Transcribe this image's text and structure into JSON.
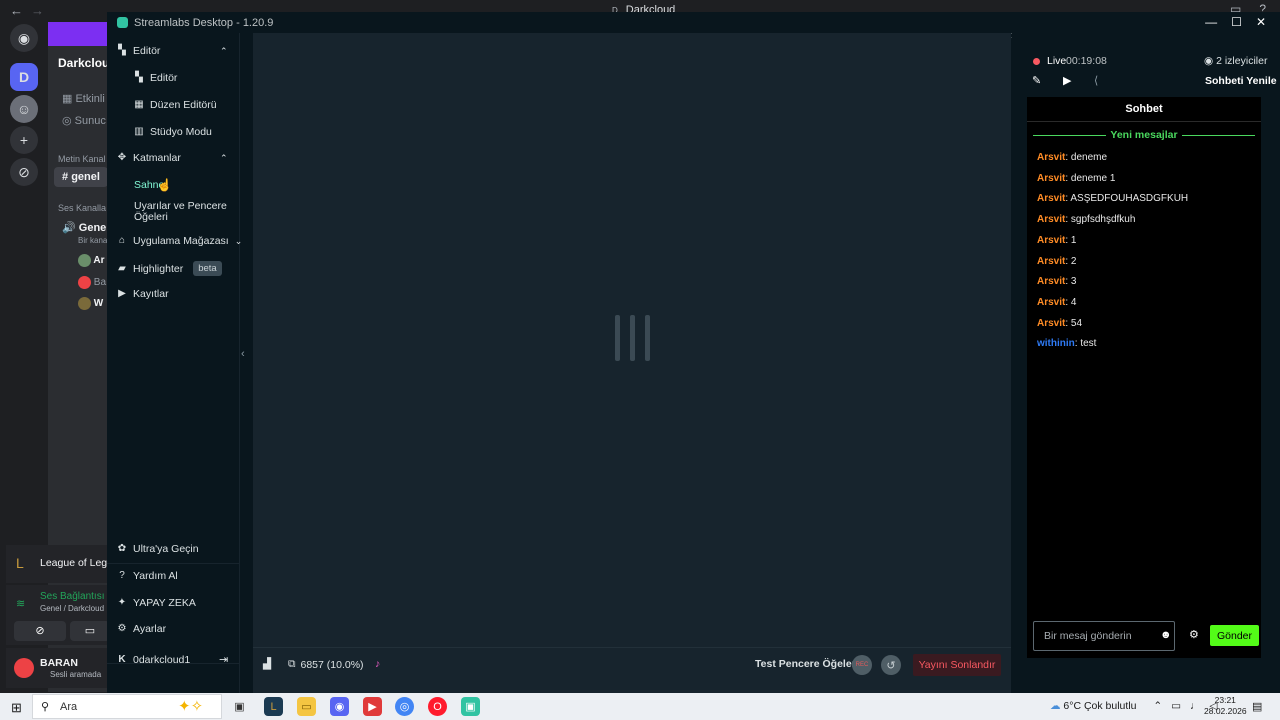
{
  "discord": {
    "window_title": "Darkcloud",
    "server_initial": "D",
    "server_name": "Darkcloud",
    "channels": {
      "events": "Etkinli",
      "server_guide": "Sunuc",
      "text_header": "Metin Kanal",
      "text_channel": "genel",
      "voice_header": "Ses Kanalla",
      "voice_channel": "Genel",
      "voice_sub": "Bir kanal",
      "members": [
        "Ar",
        "Ba",
        "W"
      ]
    },
    "activity": "League of Lege",
    "voice_status": "Ses Bağlantısı",
    "voice_location": "Genel / Darkcloud",
    "user_name": "BARAN",
    "user_status": "Sesli aramada"
  },
  "streamlabs": {
    "title": "Streamlabs Desktop - 1.20.9",
    "nav": {
      "editor_group": "Editör",
      "editor": "Editör",
      "layout_editor": "Düzen Editörü",
      "studio_mode": "Stüdyo Modu",
      "layers_group": "Katmanlar",
      "scene": "Sahne",
      "alerts_widgets": "Uyarılar ve Pencere Öğeleri",
      "app_store": "Uygulama Mağazası",
      "highlighter": "Highlighter",
      "highlighter_badge": "beta",
      "recordings": "Kayıtlar",
      "ultra": "Ultra'ya Geçin",
      "help": "Yardım Al",
      "ai": "YAPAY ZEKA",
      "settings": "Ayarlar",
      "account": "0darkcloud1"
    },
    "footer": {
      "stats": "6857 (10.0%)",
      "test_widgets": "Test Pencere Öğeleri",
      "rec_label": "REC",
      "end_stream": "Yayını Sonlandır"
    },
    "stream": {
      "live_label": "Live",
      "live_time": "00:19:08",
      "viewers": "2 izleyiciler",
      "refresh_chat": "Sohbeti Yenile"
    },
    "chat": {
      "title": "Sohbet",
      "new_messages": "Yeni mesajlar",
      "messages": [
        {
          "user": "Arsvit",
          "text": ": deneme"
        },
        {
          "user": "Arsvit",
          "text": ": deneme 1"
        },
        {
          "user": "Arsvit",
          "text": ": ASŞEDFOUHASDGFKUH"
        },
        {
          "user": "Arsvit",
          "text": ": sgpfsdhşdfkuh"
        },
        {
          "user": "Arsvit",
          "text": ": 1"
        },
        {
          "user": "Arsvit",
          "text": ": 2"
        },
        {
          "user": "Arsvit",
          "text": ": 3"
        },
        {
          "user": "Arsvit",
          "text": ": 4"
        },
        {
          "user": "Arsvit",
          "text": ": 54"
        },
        {
          "user": "withinin",
          "text": ": test"
        }
      ],
      "input_placeholder": "Bir mesaj gönderin",
      "send_label": "Gönder"
    }
  },
  "taskbar": {
    "search_label": "Ara",
    "weather": "6°C  Çok bulutlu",
    "time": "23:21",
    "date": "28.02.2026",
    "notification_count": "2"
  },
  "colors": {
    "accent_green": "#53fc18",
    "live_red": "#f85961",
    "user_orange": "#ff8c26",
    "user_blue": "#2f7bf5"
  }
}
